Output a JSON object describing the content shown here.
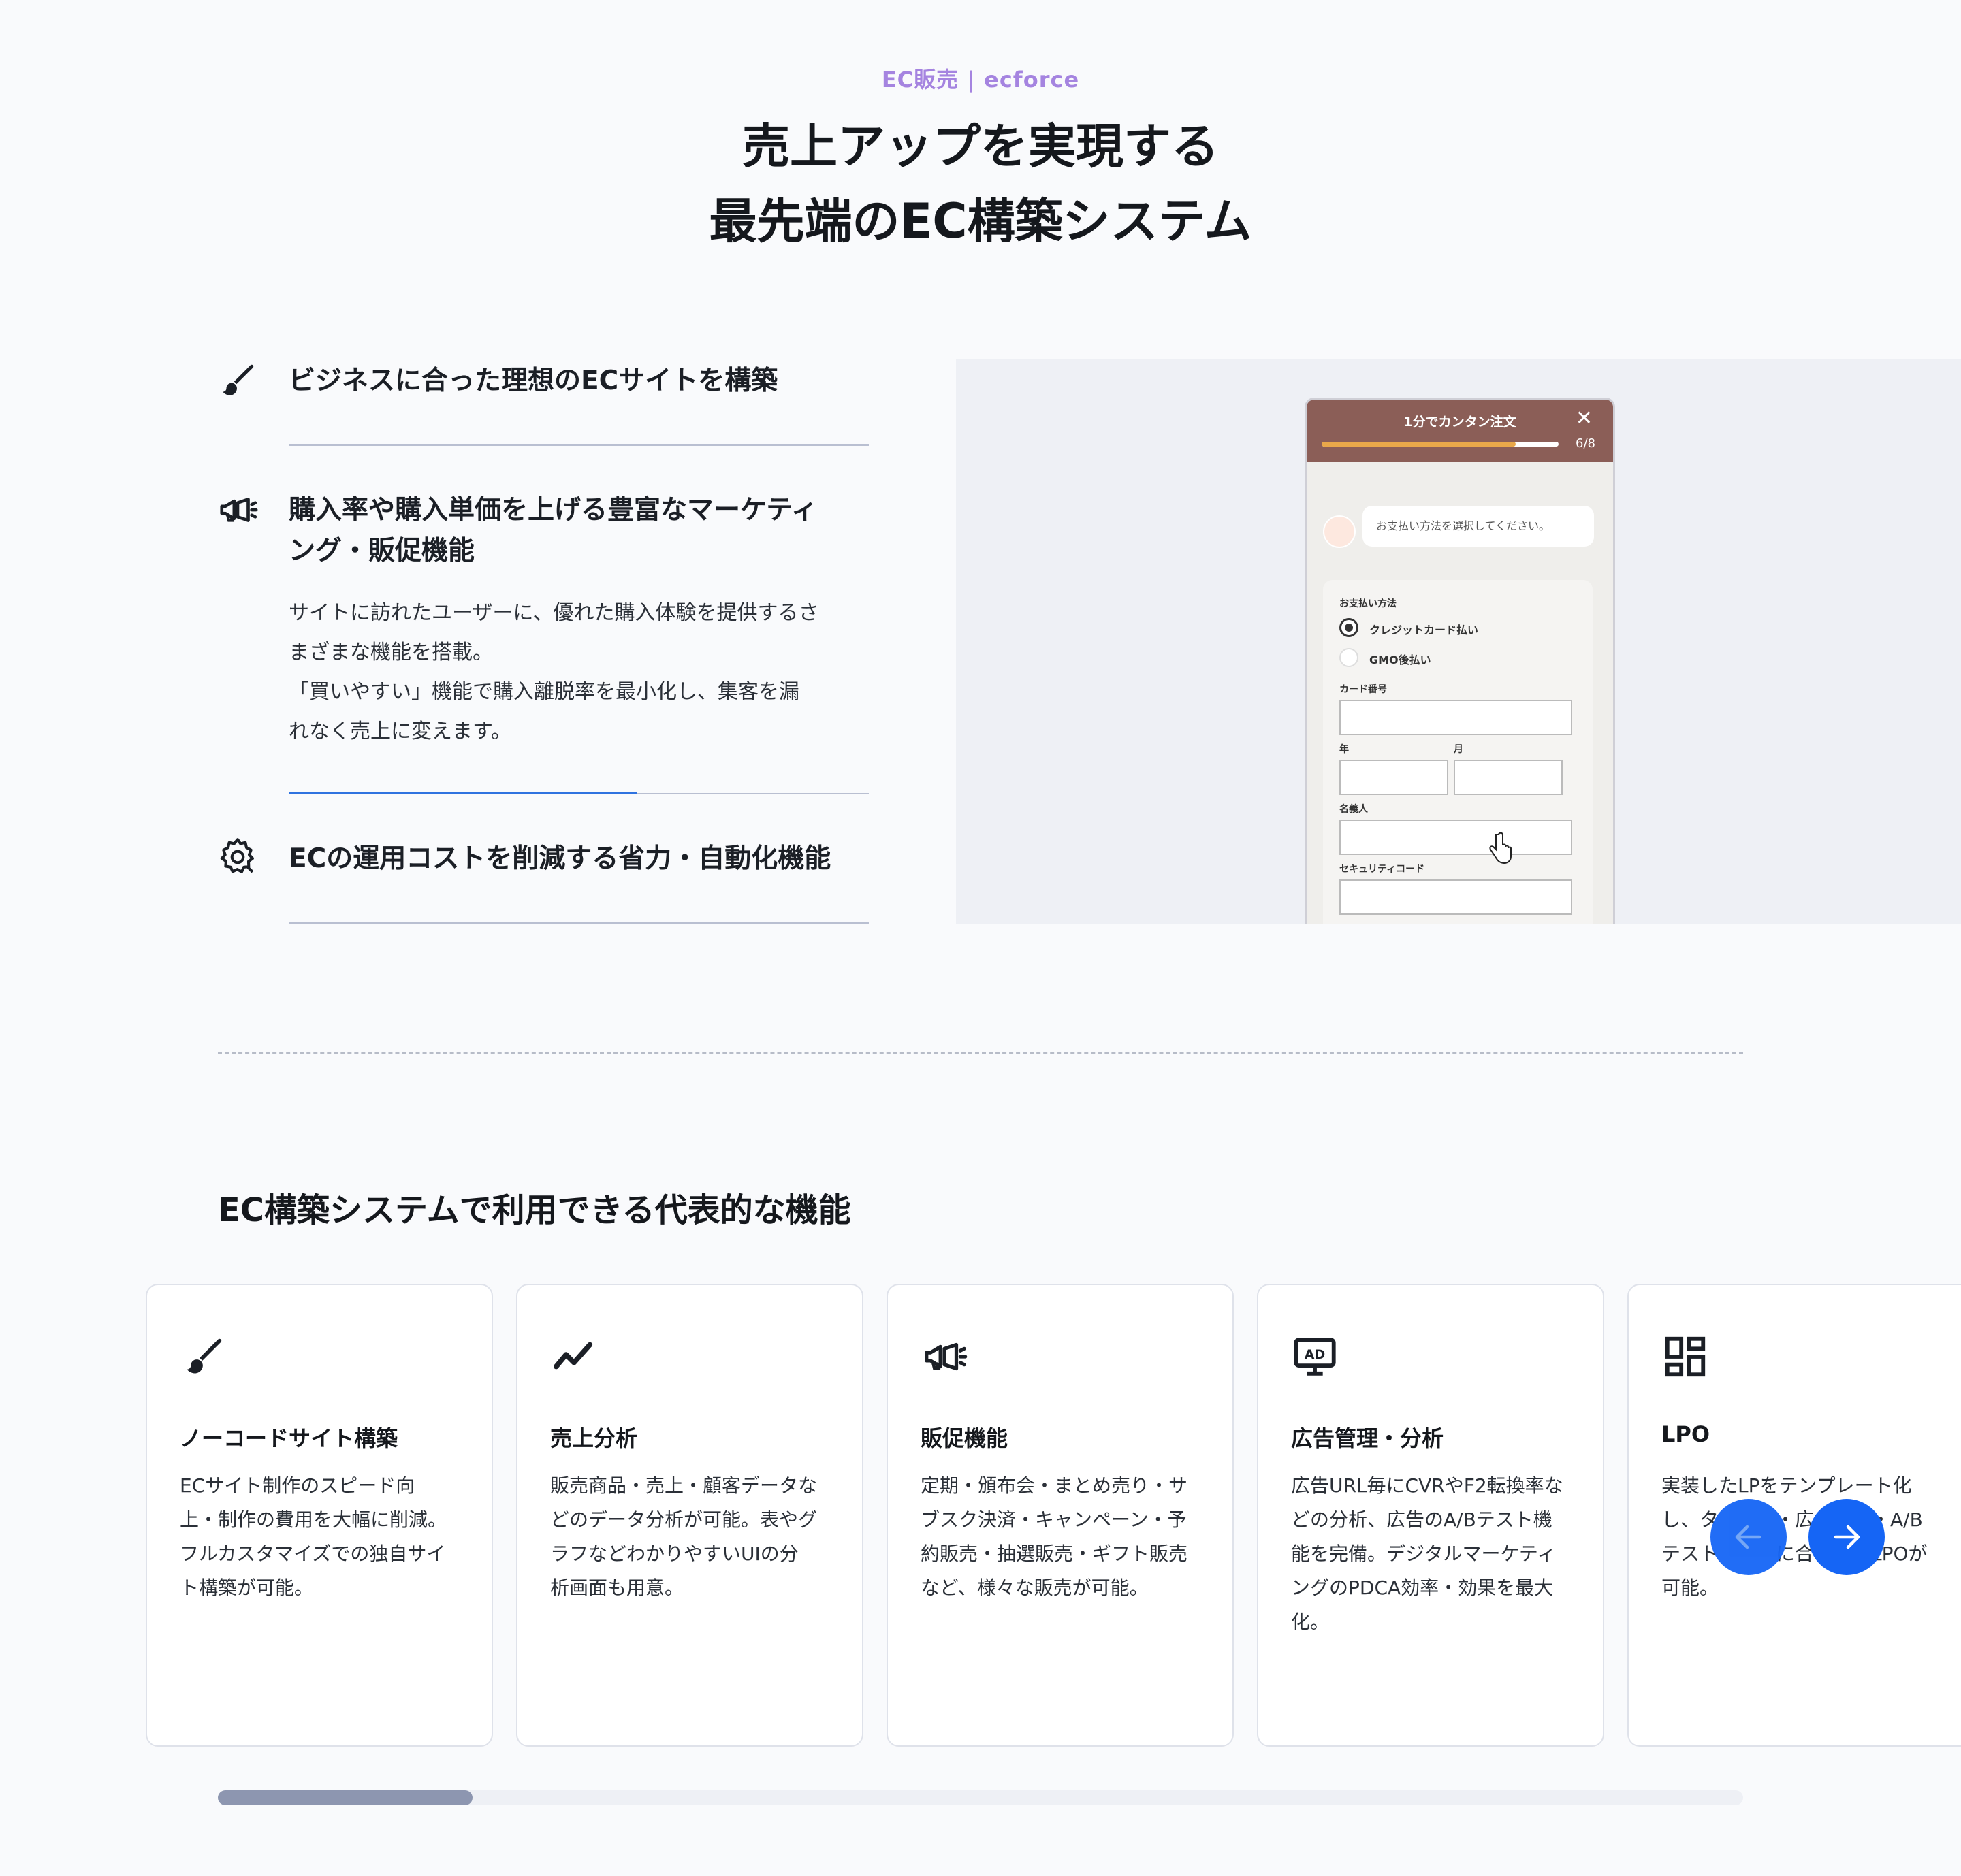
{
  "header": {
    "eyebrow": "EC販売 | ecforce",
    "title_line1": "売上アップを実現する",
    "title_line2": "最先端のEC構築システム"
  },
  "features": [
    {
      "icon": "paintbrush-icon",
      "title": "ビジネスに合った理想のECサイトを構築"
    },
    {
      "icon": "megaphone-icon",
      "title_line1": "購入率や購入単価を上げる豊富なマーケティ",
      "title_line2": "ング・販促機能",
      "body_line1": "サイトに訪れたユーザーに、優れた購入体験を提供するさ",
      "body_line2": "まざまな機能を搭載。",
      "body_line3": "「買いやすい」機能で購入離脱率を最小化し、集客を漏",
      "body_line4": "れなく売上に変えます。",
      "progress": 0.6
    },
    {
      "icon": "gear-icon",
      "title": "ECの運用コストを削減する省力・自動化機能"
    }
  ],
  "mock_form": {
    "header_title": "1分でカンタン注文",
    "close": "✕",
    "step": "6/8",
    "progress": 0.82,
    "chat_message": "お支払い方法を選択してください。",
    "payment_label": "お支払い方法",
    "option_credit": "クレジットカード払い",
    "option_gmo": "GMO後払い",
    "card_number_label": "カード番号",
    "year_label": "年",
    "month_label": "月",
    "name_label": "名義人",
    "security_label": "セキュリティコード"
  },
  "section2": {
    "title": "EC構築システムで利用できる代表的な機能"
  },
  "cards": [
    {
      "icon": "paintbrush-icon",
      "title": "ノーコードサイト構築",
      "lines": [
        "ECサイト制作のスピード向",
        "上・制作の費用を大幅に削減。",
        "フルカスタマイズでの独自サイ",
        "ト構築が可能。"
      ]
    },
    {
      "icon": "trend-chart-icon",
      "title": "売上分析",
      "lines": [
        "販売商品・売上・顧客データな",
        "どのデータ分析が可能。表やグ",
        "ラフなどわかりやすいUIの分",
        "析画面も用意。"
      ]
    },
    {
      "icon": "megaphone-icon",
      "title": "販促機能",
      "lines": [
        "定期・頒布会・まとめ売り・サ",
        "ブスク決済・キャンペーン・予",
        "約販売・抽選販売・ギフト販売",
        "など、様々な販売が可能。"
      ]
    },
    {
      "icon": "ad-monitor-icon",
      "title": "広告管理・分析",
      "lines": [
        "広告URL毎にCVRやF2転換率な",
        "どの分析、広告のA/Bテスト機",
        "能を完備。デジタルマーケティ",
        "ングのPDCA効率・効果を最大",
        "化。"
      ]
    },
    {
      "icon": "layout-grid-icon",
      "title": "LPO",
      "lines": [
        "実装したLPをテンプレート化",
        "し、タ　　　・広　　　・A/B",
        "テスト　　　に合　　　LPOが",
        "可能。"
      ]
    }
  ],
  "carousel": {
    "prev_icon": "arrow-left-icon",
    "next_icon": "arrow-right-icon",
    "scroll_position": 0.167
  }
}
